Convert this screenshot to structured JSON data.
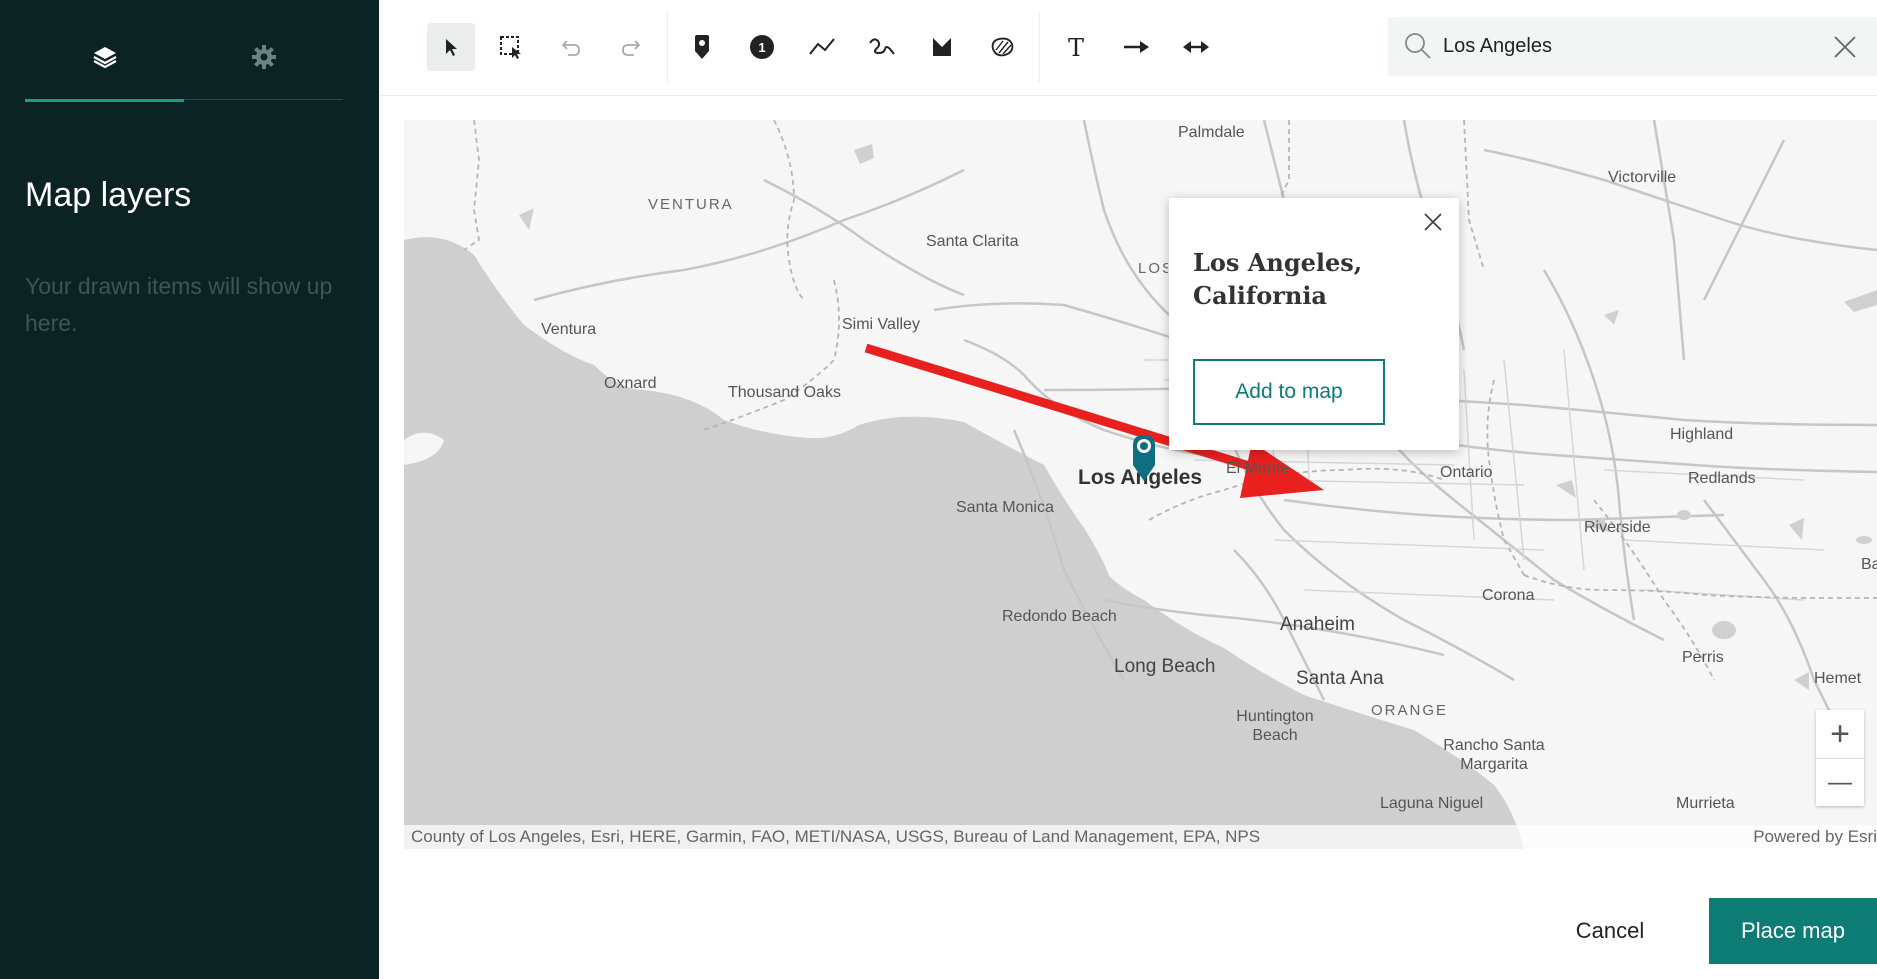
{
  "sidebar": {
    "tabs": [
      {
        "name": "layers",
        "icon": "layers-icon"
      },
      {
        "name": "settings",
        "icon": "gear-icon"
      }
    ],
    "title": "Map layers",
    "empty_message": "Your drawn items will show up here."
  },
  "toolbar": {
    "tools": [
      {
        "id": "select",
        "icon": "pointer-icon",
        "active": true
      },
      {
        "id": "marquee",
        "icon": "marquee-select-icon"
      },
      {
        "id": "undo",
        "icon": "undo-icon"
      },
      {
        "id": "redo",
        "icon": "redo-icon"
      },
      {
        "id": "pin",
        "icon": "map-pin-icon"
      },
      {
        "id": "numbered-marker",
        "icon": "numbered-marker-icon",
        "label": "1"
      },
      {
        "id": "line",
        "icon": "polyline-icon"
      },
      {
        "id": "freehand",
        "icon": "freehand-icon"
      },
      {
        "id": "polygon",
        "icon": "polygon-icon"
      },
      {
        "id": "freehand-area",
        "icon": "freehand-area-icon"
      },
      {
        "id": "text",
        "icon": "text-icon",
        "label": "T"
      },
      {
        "id": "arrow",
        "icon": "arrow-icon"
      },
      {
        "id": "double-arrow",
        "icon": "double-arrow-icon"
      }
    ],
    "search": {
      "value": "Los Angeles",
      "icon": "search-icon",
      "clear_icon": "close-icon"
    }
  },
  "map": {
    "labels": {
      "palmdale": "Palmdale",
      "victorville": "Victorville",
      "ventura_county": "VENTURA",
      "santa_clarita": "Santa Clarita",
      "la_county": "LOS ANGE",
      "ventura": "Ventura",
      "simi_valley": "Simi Valley",
      "oxnard": "Oxnard",
      "thousand_oaks": "Thousand Oaks",
      "los_angeles": "Los Angeles",
      "el_monte": "El Monte",
      "ontario": "Ontario",
      "highland": "Highland",
      "redlands": "Redlands",
      "santa_monica": "Santa Monica",
      "riverside": "Riverside",
      "ba": "Ba",
      "corona": "Corona",
      "redondo_beach": "Redondo Beach",
      "anaheim": "Anaheim",
      "perris": "Perris",
      "long_beach": "Long Beach",
      "santa_ana": "Santa Ana",
      "hemet": "Hemet",
      "orange_county": "ORANGE",
      "huntington_beach": "Huntington Beach",
      "rancho_santa_margarita": "Rancho Santa Margarita",
      "laguna_niguel": "Laguna Niguel",
      "murrieta": "Murrieta"
    },
    "attribution": "County of Los Angeles, Esri, HERE, Garmin, FAO, METI/NASA, USGS, Bureau of Land Management, EPA, NPS",
    "powered_by": "Powered by Esri",
    "zoom_in": "+",
    "zoom_out": "—",
    "popup": {
      "title": "Los Angeles, California",
      "add_button": "Add to map"
    }
  },
  "footer": {
    "cancel": "Cancel",
    "place": "Place map"
  },
  "colors": {
    "sidebar_bg": "#0c2323",
    "accent": "#0d7c74",
    "tab_underline": "#1c9b93",
    "annotation_arrow": "#e8201e",
    "pin": "#0f6e82"
  }
}
